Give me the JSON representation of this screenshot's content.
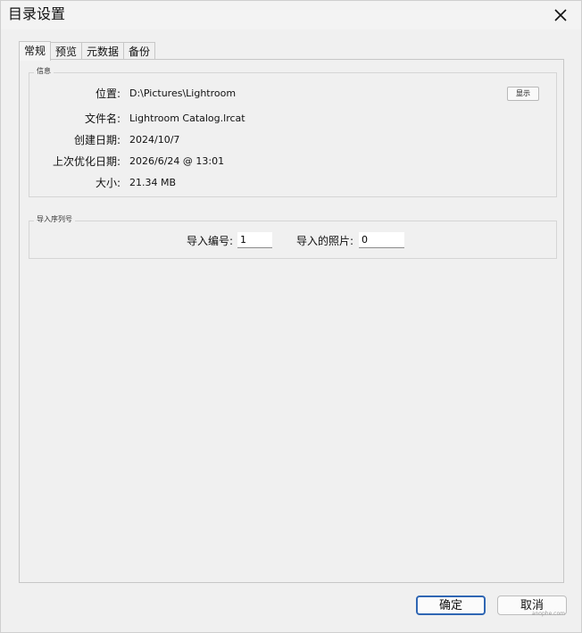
{
  "window": {
    "title": "目录设置"
  },
  "tabs": [
    {
      "label": "常规",
      "active": true
    },
    {
      "label": "预览",
      "active": false
    },
    {
      "label": "元数据",
      "active": false
    },
    {
      "label": "备份",
      "active": false
    }
  ],
  "info": {
    "legend": "信息",
    "location_label": "位置:",
    "location_value": "D:\\Pictures\\Lightroom",
    "filename_label": "文件名:",
    "filename_value": "Lightroom Catalog.lrcat",
    "created_label": "创建日期:",
    "created_value": "2024/10/7",
    "optimized_label": "上次优化日期:",
    "optimized_value": "2026/6/24 @ 13:01",
    "size_label": "大小:",
    "size_value": "21.34 MB",
    "show_button": "显示"
  },
  "import": {
    "legend": "导入序列号",
    "number_label": "导入编号:",
    "number_value": "1",
    "photos_label": "导入的照片:",
    "photos_value": "0"
  },
  "footer": {
    "ok_label": "确定",
    "cancel_label": "取消",
    "watermark": "anophe.com"
  },
  "icons": {
    "close": "close-icon"
  }
}
